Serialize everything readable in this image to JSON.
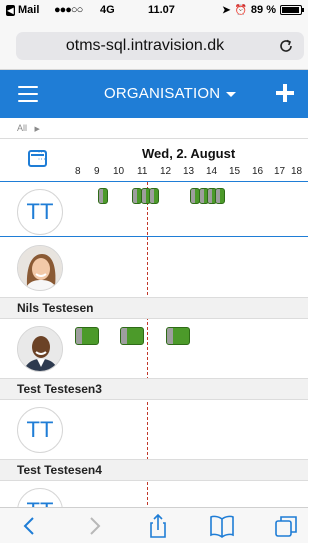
{
  "status_bar": {
    "back_app": "Mail",
    "signal": "●●●○○",
    "network": "4G",
    "time": "11.07",
    "battery": "89 %"
  },
  "browser": {
    "url": "otms-sql.intravision.dk"
  },
  "header": {
    "title": "ORGANISATION"
  },
  "breadcrumb": {
    "label": "All"
  },
  "schedule": {
    "date": "Wed, 2. August",
    "hours": [
      "8",
      "9",
      "10",
      "11",
      "12",
      "13",
      "14",
      "15",
      "16",
      "17",
      "18"
    ]
  },
  "rows": [
    {
      "avatar_text": "TT",
      "name": ""
    },
    {
      "avatar_text": "",
      "name": "Nils Testesen"
    },
    {
      "avatar_text": "",
      "name": "Test Testesen3"
    },
    {
      "avatar_text": "TT",
      "name": "Test Testesen4"
    },
    {
      "avatar_text": "TT",
      "name": ""
    }
  ],
  "colors": {
    "brand": "#1f7dd6",
    "event_green": "#4c9a2a",
    "now_line": "#c0392b"
  }
}
